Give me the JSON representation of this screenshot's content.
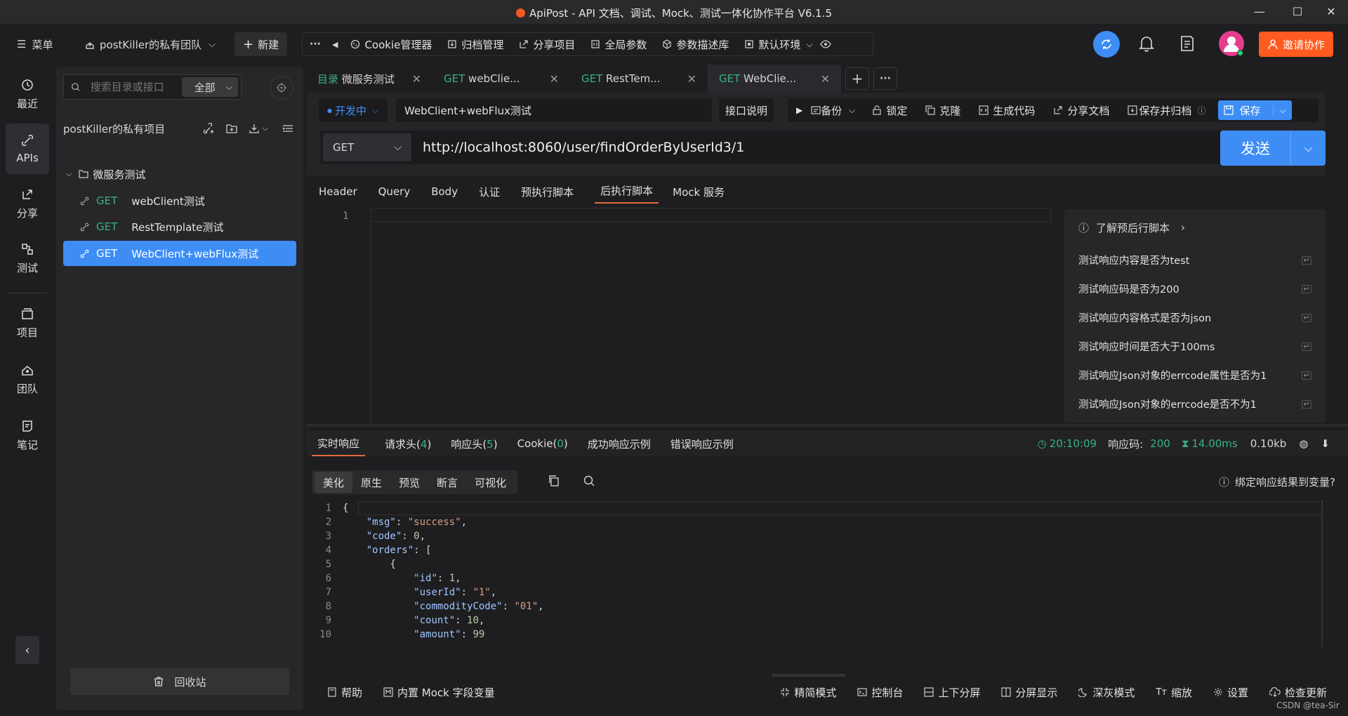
{
  "title_bar": {
    "title": "ApiPost - API 文档、调试、Mock、测试一体化协作平台 V6.1.5"
  },
  "top_bar": {
    "menu": "菜单",
    "team": "postKiller的私有团队",
    "new": "新建",
    "more": "···",
    "items": [
      "Cookie管理器",
      "归档管理",
      "分享项目",
      "全局参数",
      "参数描述库",
      "默认环境"
    ],
    "invite": "邀请协作"
  },
  "left_nav": {
    "items": [
      {
        "label": "最近",
        "icon": "history-icon"
      },
      {
        "label": "APIs",
        "icon": "api-icon"
      },
      {
        "label": "分享",
        "icon": "share-icon"
      },
      {
        "label": "测试",
        "icon": "test-icon"
      },
      {
        "label": "项目",
        "icon": "project-icon"
      },
      {
        "label": "团队",
        "icon": "team-icon"
      },
      {
        "label": "笔记",
        "icon": "note-icon"
      }
    ]
  },
  "tree": {
    "search_placeholder": "搜索目录或接口",
    "filter": "全部",
    "project": "postKiller的私有项目",
    "folder": "微服务测试",
    "items": [
      {
        "method": "GET",
        "name": "webClient测试"
      },
      {
        "method": "GET",
        "name": "RestTemplate测试"
      },
      {
        "method": "GET",
        "name": "WebClient+webFlux测试"
      }
    ],
    "recycle": "回收站"
  },
  "tabs": [
    {
      "prefix": "目录",
      "label": "微服务测试"
    },
    {
      "prefix": "GET",
      "label": "webClie..."
    },
    {
      "prefix": "GET",
      "label": "RestTem..."
    },
    {
      "prefix": "GET",
      "label": "WebClie..."
    }
  ],
  "request": {
    "status": "开发中",
    "name": "WebClient+webFlux测试",
    "doc": "接口说明",
    "actions": [
      "备份",
      "锁定",
      "克隆",
      "生成代码",
      "分享文档",
      "保存并归档"
    ],
    "save": "保存",
    "method": "GET",
    "url": "http://localhost:8060/user/findOrderByUserId3/1",
    "send": "发送"
  },
  "req_tabs": [
    "Header",
    "Query",
    "Body",
    "认证",
    "预执行脚本",
    "后执行脚本",
    "Mock 服务"
  ],
  "editor": {
    "line": "1"
  },
  "snippets": {
    "header": "了解预后行脚本",
    "items": [
      "测试响应内容是否为test",
      "测试响应码是否为200",
      "测试响应内容格式是否为json",
      "测试响应时间是否大于100ms",
      "测试响应Json对象的errcode属性是否为1",
      "测试响应Json对象的errcode是否不为1"
    ]
  },
  "response": {
    "tabs": [
      {
        "label": "实时响应",
        "count": ""
      },
      {
        "label": "请求头",
        "count": "4"
      },
      {
        "label": "响应头",
        "count": "5"
      },
      {
        "label": "Cookie",
        "count": "0"
      },
      {
        "label": "成功响应示例",
        "count": ""
      },
      {
        "label": "错误响应示例",
        "count": ""
      }
    ],
    "time": "20:10:09",
    "code_label": "响应码:",
    "code": "200",
    "duration": "14.00ms",
    "size": "0.10kb",
    "views": [
      "美化",
      "原生",
      "预览",
      "断言",
      "可视化"
    ],
    "bind": "绑定响应结果到变量?"
  },
  "code_lines": [
    {
      "n": "1",
      "indent": "",
      "parts": [
        [
          "p",
          "{"
        ]
      ]
    },
    {
      "n": "2",
      "indent": "    ",
      "parts": [
        [
          "k",
          "\"msg\""
        ],
        [
          "p",
          ": "
        ],
        [
          "s",
          "\"success\""
        ],
        [
          "p",
          ","
        ]
      ]
    },
    {
      "n": "3",
      "indent": "    ",
      "parts": [
        [
          "k",
          "\"code\""
        ],
        [
          "p",
          ": "
        ],
        [
          "num",
          "0"
        ],
        [
          "p",
          ","
        ]
      ]
    },
    {
      "n": "4",
      "indent": "    ",
      "parts": [
        [
          "k",
          "\"orders\""
        ],
        [
          "p",
          ": ["
        ]
      ]
    },
    {
      "n": "5",
      "indent": "        ",
      "parts": [
        [
          "p",
          "{"
        ]
      ]
    },
    {
      "n": "6",
      "indent": "            ",
      "parts": [
        [
          "k",
          "\"id\""
        ],
        [
          "p",
          ": "
        ],
        [
          "num",
          "1"
        ],
        [
          "p",
          ","
        ]
      ]
    },
    {
      "n": "7",
      "indent": "            ",
      "parts": [
        [
          "k",
          "\"userId\""
        ],
        [
          "p",
          ": "
        ],
        [
          "s",
          "\"1\""
        ],
        [
          "p",
          ","
        ]
      ]
    },
    {
      "n": "8",
      "indent": "            ",
      "parts": [
        [
          "k",
          "\"commodityCode\""
        ],
        [
          "p",
          ": "
        ],
        [
          "s",
          "\"01\""
        ],
        [
          "p",
          ","
        ]
      ]
    },
    {
      "n": "9",
      "indent": "            ",
      "parts": [
        [
          "k",
          "\"count\""
        ],
        [
          "p",
          ": "
        ],
        [
          "num",
          "10"
        ],
        [
          "p",
          ","
        ]
      ]
    },
    {
      "n": "10",
      "indent": "            ",
      "parts": [
        [
          "k",
          "\"amount\""
        ],
        [
          "p",
          ": "
        ],
        [
          "num",
          "99"
        ]
      ]
    }
  ],
  "bottom": {
    "left": [
      "帮助",
      "内置 Mock 字段变量"
    ],
    "right": [
      "精简模式",
      "控制台",
      "上下分屏",
      "分屏显示",
      "深灰模式",
      "缩放",
      "设置",
      "检查更新"
    ],
    "watermark": "CSDN @tea-Sir"
  },
  "colors": {
    "accent": "#3d8df5",
    "invite": "#ff5a1f",
    "get": "#36b37e",
    "active_tab_underline": "#e06c3b"
  }
}
